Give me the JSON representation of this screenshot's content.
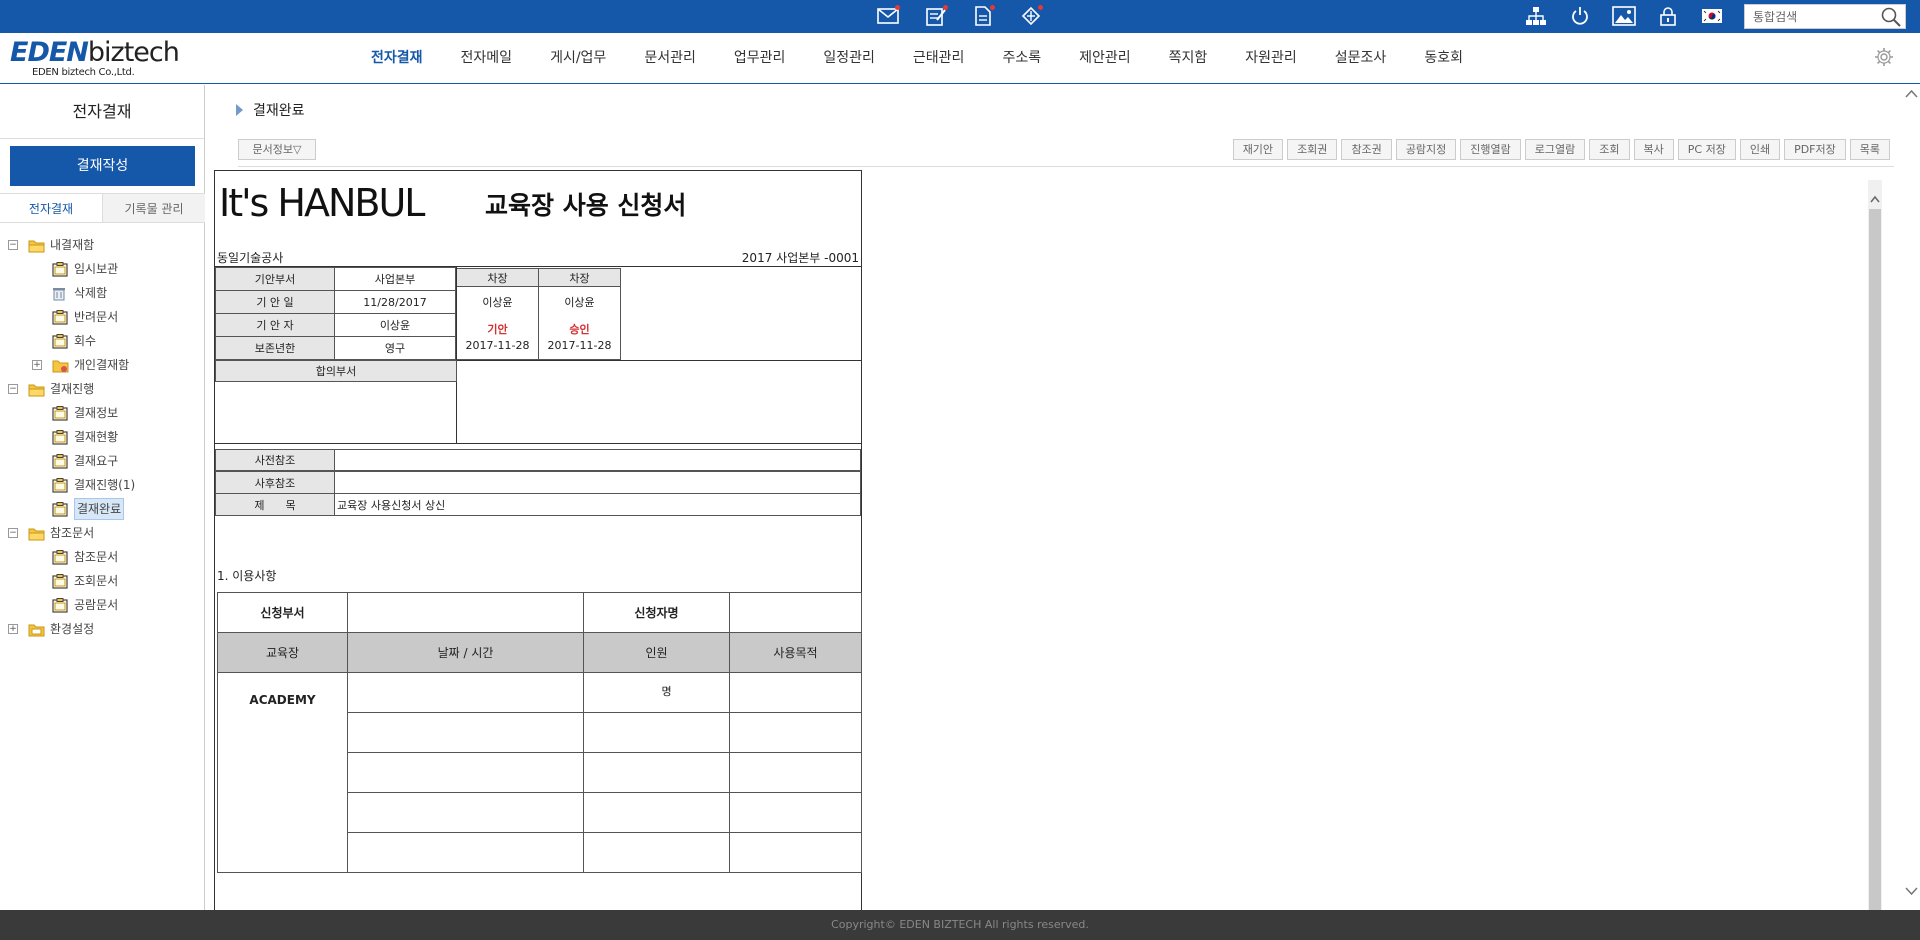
{
  "topbar": {
    "icons": [
      "mail-icon",
      "approval-icon",
      "document-icon",
      "share-icon"
    ],
    "right_icons": [
      "org-chart-icon",
      "power-icon",
      "image-icon",
      "lock-icon",
      "korea-flag-icon"
    ],
    "search": {
      "placeholder": "통합검색"
    }
  },
  "logo": {
    "brand_main": "EDEN",
    "brand_sub": "biztech",
    "company": "EDEN biztech Co.,Ltd."
  },
  "nav": {
    "items": [
      "전자결재",
      "전자메일",
      "게시/업무",
      "문서관리",
      "업무관리",
      "일정관리",
      "근태관리",
      "주소록",
      "제안관리",
      "쪽지함",
      "자원관리",
      "설문조사",
      "동호회"
    ],
    "active_index": 0
  },
  "sidebar": {
    "title": "전자결재",
    "compose_label": "결재작성",
    "tabs": [
      "전자결재",
      "기록물 관리"
    ],
    "tree": [
      {
        "label": "내결재함",
        "level": 0,
        "toggle": "-",
        "icon": "folder-open-icon"
      },
      {
        "label": "임시보관",
        "level": 1,
        "icon": "folder-doc-icon"
      },
      {
        "label": "삭제함",
        "level": 1,
        "icon": "trash-icon"
      },
      {
        "label": "반려문서",
        "level": 1,
        "icon": "folder-doc-icon"
      },
      {
        "label": "회수",
        "level": 1,
        "icon": "folder-doc-icon"
      },
      {
        "label": "개인결재함",
        "level": 1,
        "toggle": "+",
        "icon": "folder-gear-icon"
      },
      {
        "label": "결재진행",
        "level": 0,
        "toggle": "-",
        "icon": "folder-open-icon"
      },
      {
        "label": "결재정보",
        "level": 1,
        "icon": "folder-doc-icon"
      },
      {
        "label": "결재현황",
        "level": 1,
        "icon": "folder-doc-icon"
      },
      {
        "label": "결재요구",
        "level": 1,
        "icon": "folder-doc-icon"
      },
      {
        "label": "결재진행(1)",
        "level": 1,
        "icon": "folder-doc-icon"
      },
      {
        "label": "결재완료",
        "level": 1,
        "icon": "folder-doc-icon",
        "selected": true
      },
      {
        "label": "참조문서",
        "level": 0,
        "toggle": "-",
        "icon": "folder-open-icon"
      },
      {
        "label": "참조문서",
        "level": 1,
        "icon": "folder-doc-icon"
      },
      {
        "label": "조회문서",
        "level": 1,
        "icon": "folder-doc-icon"
      },
      {
        "label": "공람문서",
        "level": 1,
        "icon": "folder-doc-icon"
      },
      {
        "label": "환경설정",
        "level": 0,
        "toggle": "+",
        "icon": "folder-settings-icon"
      }
    ]
  },
  "content": {
    "breadcrumb": "결재완료",
    "docinfo_label": "문서정보▽",
    "toolbar": [
      "재기안",
      "조회권",
      "참조권",
      "공람지정",
      "진행열람",
      "로그열람",
      "조회",
      "복사",
      "PC 저장",
      "인쇄",
      "PDF저장",
      "목록"
    ]
  },
  "document": {
    "brand": "It's HANBUL",
    "title": "교육장 사용 신청서",
    "org": "동일기술공사",
    "doc_no": "2017 사업본부 -0001",
    "info": [
      {
        "label": "기안부서",
        "value": "사업본부"
      },
      {
        "label": "기 안 일",
        "value": "11/28/2017"
      },
      {
        "label": "기 안 자",
        "value": "이상윤"
      },
      {
        "label": "보존년한",
        "value": "영구"
      }
    ],
    "approvals": [
      {
        "position": "차장",
        "name": "이상윤",
        "status": "기안",
        "date": "2017-11-28"
      },
      {
        "position": "차장",
        "name": "이상윤",
        "status": "승인",
        "date": "2017-11-28"
      }
    ],
    "agreement_label": "합의부서",
    "pre_ref_label": "사전참조",
    "post_ref_label": "사후참조",
    "subject_label": "제      목",
    "subject_value": "교육장 사용신청서 상신",
    "section_title": "1. 이용사항",
    "table": {
      "dept_label": "신청부서",
      "applicant_label": "신청자명",
      "headers": [
        "교육장",
        "날짜 / 시간",
        "인원",
        "사용목적"
      ],
      "room": "ACADEMY",
      "people_unit": "명"
    }
  },
  "footer": {
    "copyright": "Copyright© EDEN BIZTECH All rights reserved."
  },
  "colors": {
    "primary": "#1557a8",
    "approval_red": "#d32f2f",
    "footer_bg": "#3a3a3a"
  }
}
